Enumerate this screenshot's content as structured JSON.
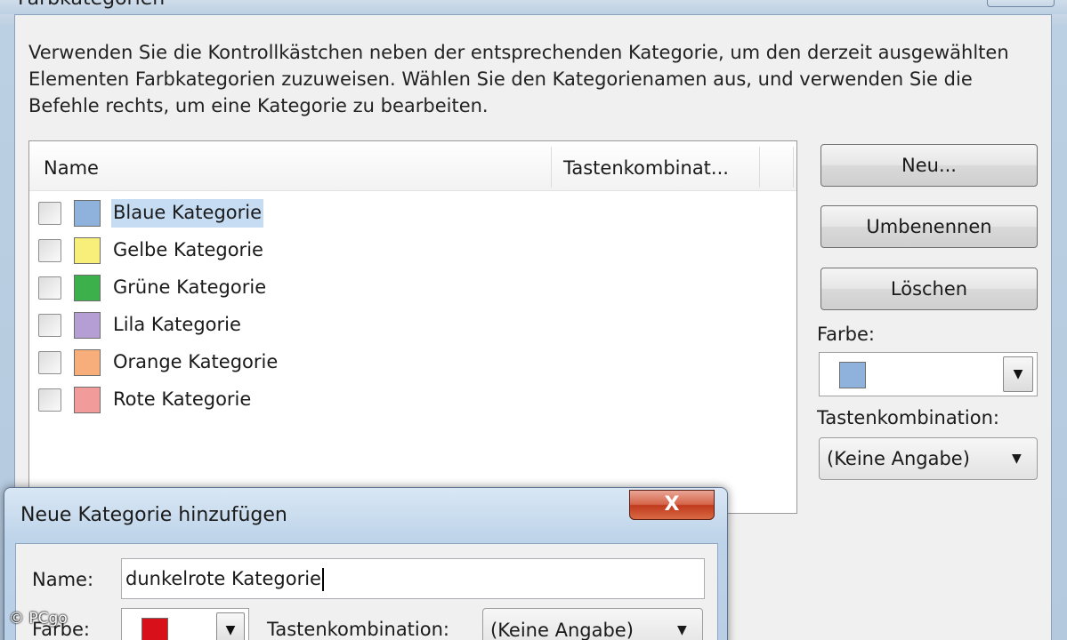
{
  "dialog": {
    "title": "Farbkategorien",
    "description": "Verwenden Sie die Kontrollkästchen neben der entsprechenden Kategorie, um den derzeit ausgewählten Elementen Farbkategorien zuzuweisen. Wählen Sie den Kategorienamen aus, und verwenden Sie die Befehle rechts, um eine Kategorie zu bearbeiten.",
    "list": {
      "columns": [
        "Name",
        "Tastenkombinat..."
      ],
      "items": [
        {
          "label": "Blaue Kategorie",
          "color": "#8fb2dc",
          "selected": true
        },
        {
          "label": "Gelbe Kategorie",
          "color": "#f8ef7a",
          "selected": false
        },
        {
          "label": "Grüne Kategorie",
          "color": "#3cb04a",
          "selected": false
        },
        {
          "label": "Lila Kategorie",
          "color": "#b59ed3",
          "selected": false
        },
        {
          "label": "Orange Kategorie",
          "color": "#f7ae7a",
          "selected": false
        },
        {
          "label": "Rote Kategorie",
          "color": "#f29b9b",
          "selected": false
        }
      ]
    },
    "buttons": {
      "new": "Neu...",
      "rename": "Umbenennen",
      "delete": "Löschen"
    },
    "color_label": "Farbe:",
    "color_value": "#8fb2dc",
    "shortcut_label": "Tastenkombination:",
    "shortcut_value": "(Keine Angabe)"
  },
  "new_category_dialog": {
    "title": "Neue Kategorie hinzufügen",
    "close_glyph": "X",
    "name_label": "Name:",
    "name_value": "dunkelrote Kategorie",
    "color_label": "Farbe:",
    "color_value": "#d8101a",
    "shortcut_label": "Tastenkombination:",
    "shortcut_value": "(Keine Angabe)"
  },
  "watermark": "© PCgo"
}
